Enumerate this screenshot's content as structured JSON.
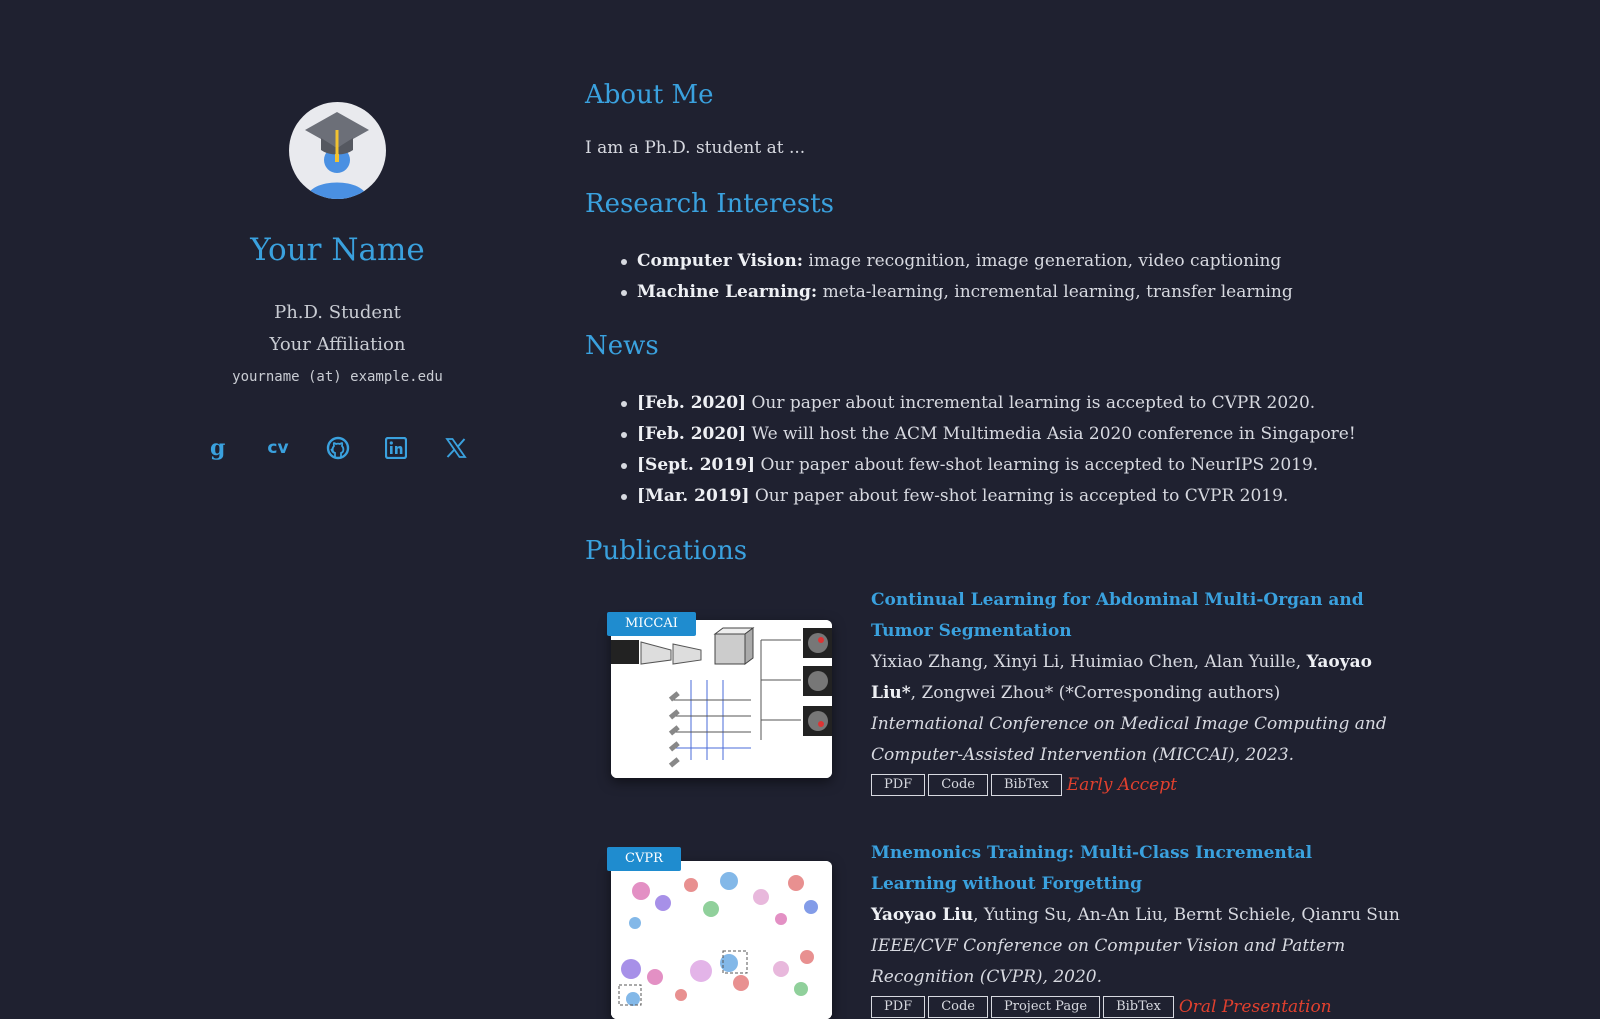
{
  "profile": {
    "name": "Your Name",
    "role": "Ph.D. Student",
    "affiliation": "Your Affiliation",
    "email": "yourname (at) example.edu",
    "socials": [
      {
        "icon": "google-scholar-icon"
      },
      {
        "icon": "cv-icon",
        "label": "cv"
      },
      {
        "icon": "github-icon"
      },
      {
        "icon": "linkedin-icon"
      },
      {
        "icon": "x-icon"
      }
    ]
  },
  "about": {
    "heading": "About Me",
    "text": "I am a Ph.D. student at ..."
  },
  "research": {
    "heading": "Research Interests",
    "items": [
      {
        "title": "Computer Vision:",
        "text": " image recognition, image generation, video captioning"
      },
      {
        "title": "Machine Learning:",
        "text": " meta-learning, incremental learning, transfer learning"
      }
    ]
  },
  "news": {
    "heading": "News",
    "items": [
      {
        "date": "[Feb. 2020]",
        "text": " Our paper about incremental learning is accepted to CVPR 2020."
      },
      {
        "date": "[Feb. 2020]",
        "text": " We will host the ACM Multimedia Asia 2020 conference in Singapore!"
      },
      {
        "date": "[Sept. 2019]",
        "text": " Our paper about few-shot learning is accepted to NeurIPS 2019."
      },
      {
        "date": "[Mar. 2019]",
        "text": " Our paper about few-shot learning is accepted to CVPR 2019."
      }
    ]
  },
  "publications": {
    "heading": "Publications",
    "items": [
      {
        "venue_badge": "MICCAI",
        "title": "Continual Learning for Abdominal Multi-Organ and Tumor Segmentation",
        "authors_before": "Yixiao Zhang, Xinyi Li, Huimiao Chen, Alan Yuille, ",
        "authors_bold": "Yaoyao Liu*",
        "authors_after": ", Zongwei Zhou* (*Corresponding authors)",
        "venue": "International Conference on Medical Image Computing and Computer-Assisted Intervention (MICCAI), 2023.",
        "buttons": [
          "PDF",
          "Code",
          "BibTex"
        ],
        "note": "Early Accept"
      },
      {
        "venue_badge": "CVPR",
        "title": "Mnemonics Training: Multi-Class Incremental Learning without Forgetting",
        "authors_before": "",
        "authors_bold": "Yaoyao Liu",
        "authors_after": ", Yuting Su, An-An Liu, Bernt Schiele, Qianru Sun",
        "venue": "IEEE/CVF Conference on Computer Vision and Pattern Recognition (CVPR), 2020.",
        "buttons": [
          "PDF",
          "Code",
          "Project Page",
          "BibTex"
        ],
        "note": "Oral Presentation"
      }
    ]
  },
  "colors": {
    "background": "#1f2130",
    "accent": "#3aa1de",
    "text": "#d7d9e0",
    "note": "#e0402e",
    "badge": "#1f8ccf"
  }
}
